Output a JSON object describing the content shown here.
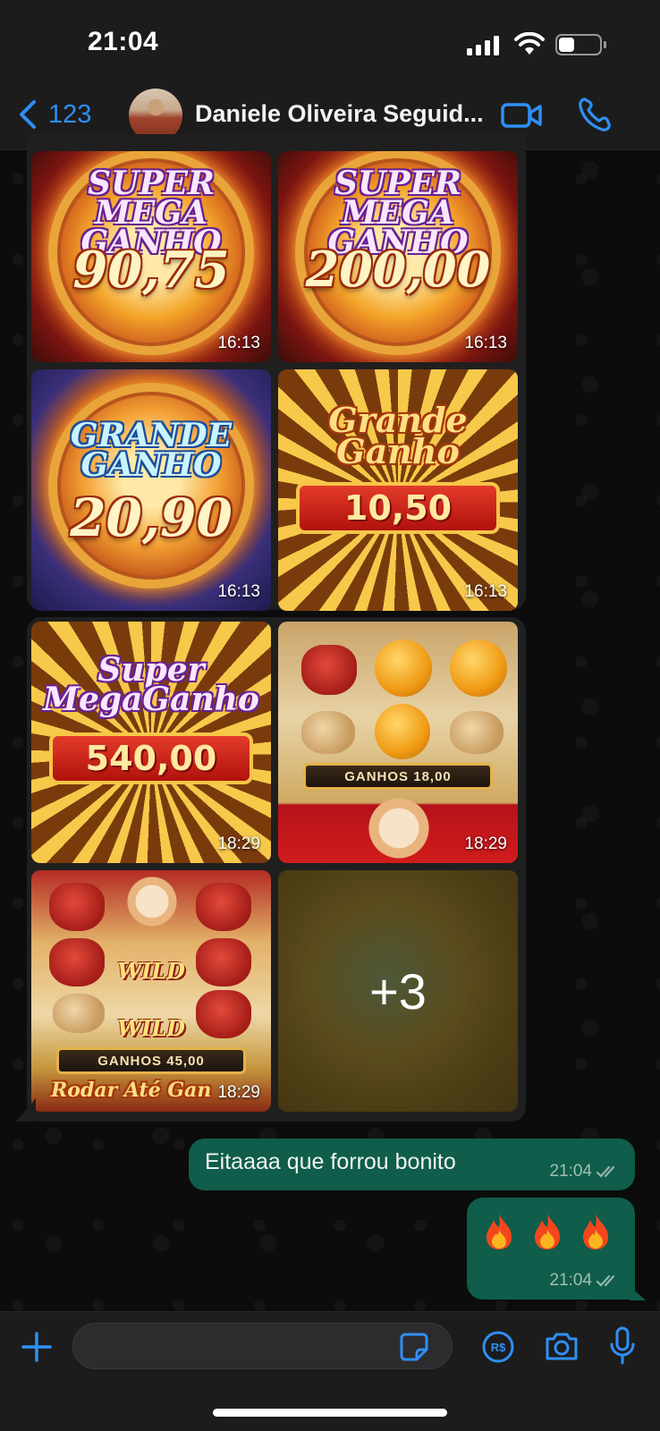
{
  "status_bar": {
    "time": "21:04",
    "battery_level": 0.35
  },
  "header": {
    "back_count": "123",
    "contact_name": "Daniele Oliveira Seguid..."
  },
  "album_1": {
    "tiles": [
      {
        "title": "SUPER\nMEGA GANHO",
        "amount": "90,75",
        "time": "16:13"
      },
      {
        "title": "SUPER\nMEGA GANHO",
        "amount": "200,00",
        "time": "16:13"
      },
      {
        "title": "GRANDE\nGANHO",
        "amount": "20,90",
        "time": "16:13"
      },
      {
        "title": "Grande\nGanho",
        "amount": "10,50",
        "time": "16:13"
      }
    ]
  },
  "album_2": {
    "tiles": [
      {
        "title": "Super\nMegaGanho",
        "amount": "540,00",
        "time": "18:29"
      },
      {
        "ganhos": "GANHOS 18,00",
        "time": "18:29"
      },
      {
        "ganhos": "GANHOS 45,00",
        "wild": "WILD",
        "bottom": "Rodar Até Gan",
        "time": "18:29"
      },
      {
        "more": "+3"
      }
    ]
  },
  "messages": [
    {
      "text": "Eitaaaa que forrou bonito",
      "time": "21:04"
    },
    {
      "emojis": [
        "fire-emoji",
        "fire-emoji",
        "fire-emoji"
      ],
      "time": "21:04"
    }
  ],
  "colors": {
    "accent": "#2f8ff6",
    "outgoing_bubble": "#0f5d4a",
    "bar_background": "#1c1c1c"
  },
  "icons": {
    "back": "chevron-left-icon",
    "video": "video-camera-icon",
    "phone": "phone-icon",
    "attach": "plus-icon",
    "sticker": "sticker-icon",
    "payment": "brl-payment-icon",
    "camera": "camera-icon",
    "mic": "microphone-icon"
  }
}
